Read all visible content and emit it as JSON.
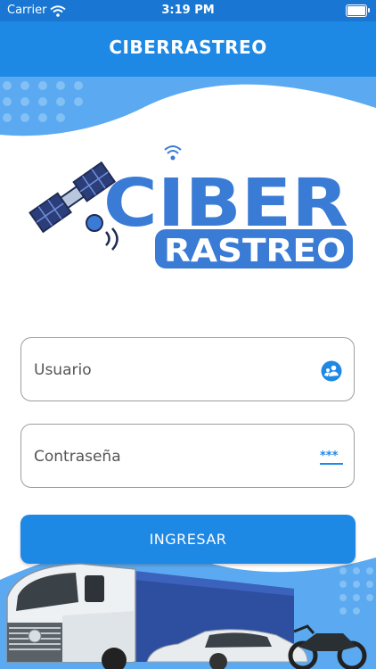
{
  "status_bar": {
    "carrier": "Carrier",
    "time": "3:19 PM"
  },
  "app_bar": {
    "title": "CIBERRASTREO"
  },
  "logo": {
    "word_top": "CIBER",
    "word_bottom": "RASTREO"
  },
  "login": {
    "username_placeholder": "Usuario",
    "password_placeholder": "Contraseña",
    "submit_label": "INGRESAR"
  },
  "colors": {
    "primary": "#1e88e5",
    "status": "#1976d2",
    "logo_blue": "#3a7bd5",
    "border": "#9e9e9e"
  }
}
